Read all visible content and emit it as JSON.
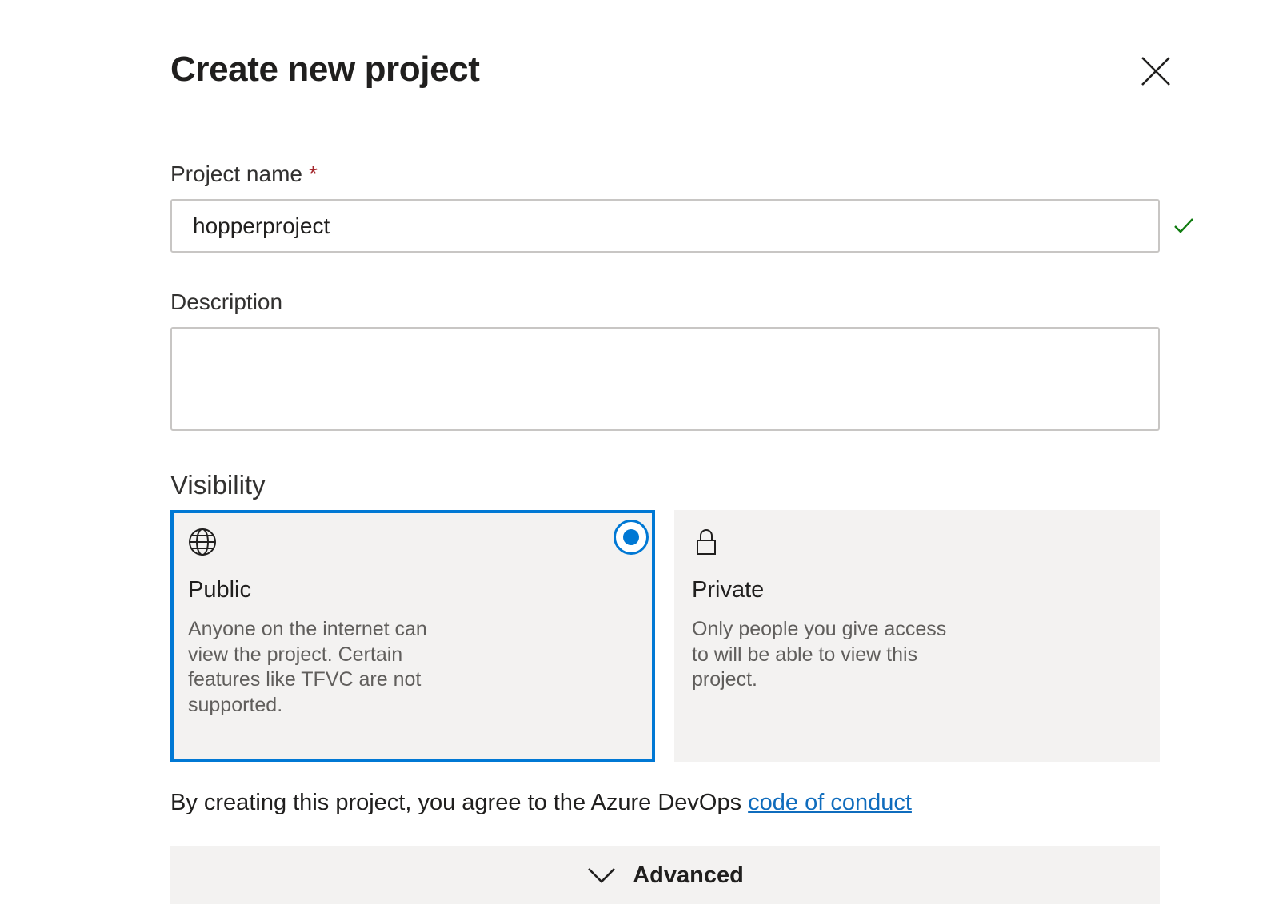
{
  "dialog": {
    "title": "Create new project",
    "close_icon": "close-icon"
  },
  "form": {
    "project_name_label": "Project name",
    "required_marker": "*",
    "project_name_value": "hopperproject",
    "valid_icon": "checkmark-icon",
    "description_label": "Description",
    "description_value": ""
  },
  "visibility": {
    "title": "Visibility",
    "selected": "Public",
    "options": [
      {
        "name": "Public",
        "icon": "globe-icon",
        "description": "Anyone on the internet can view the project. Certain features like TFVC are not supported."
      },
      {
        "name": "Private",
        "icon": "lock-icon",
        "description": "Only people you give access to will be able to view this project."
      }
    ]
  },
  "agreement": {
    "text": "By creating this project, you agree to the Azure DevOps ",
    "link_text": "code of conduct"
  },
  "advanced": {
    "label": "Advanced",
    "icon": "chevron-down-icon"
  },
  "colors": {
    "accent": "#0078d4",
    "success": "#107c10",
    "required": "#a4262c",
    "card_background": "#f3f2f1"
  }
}
